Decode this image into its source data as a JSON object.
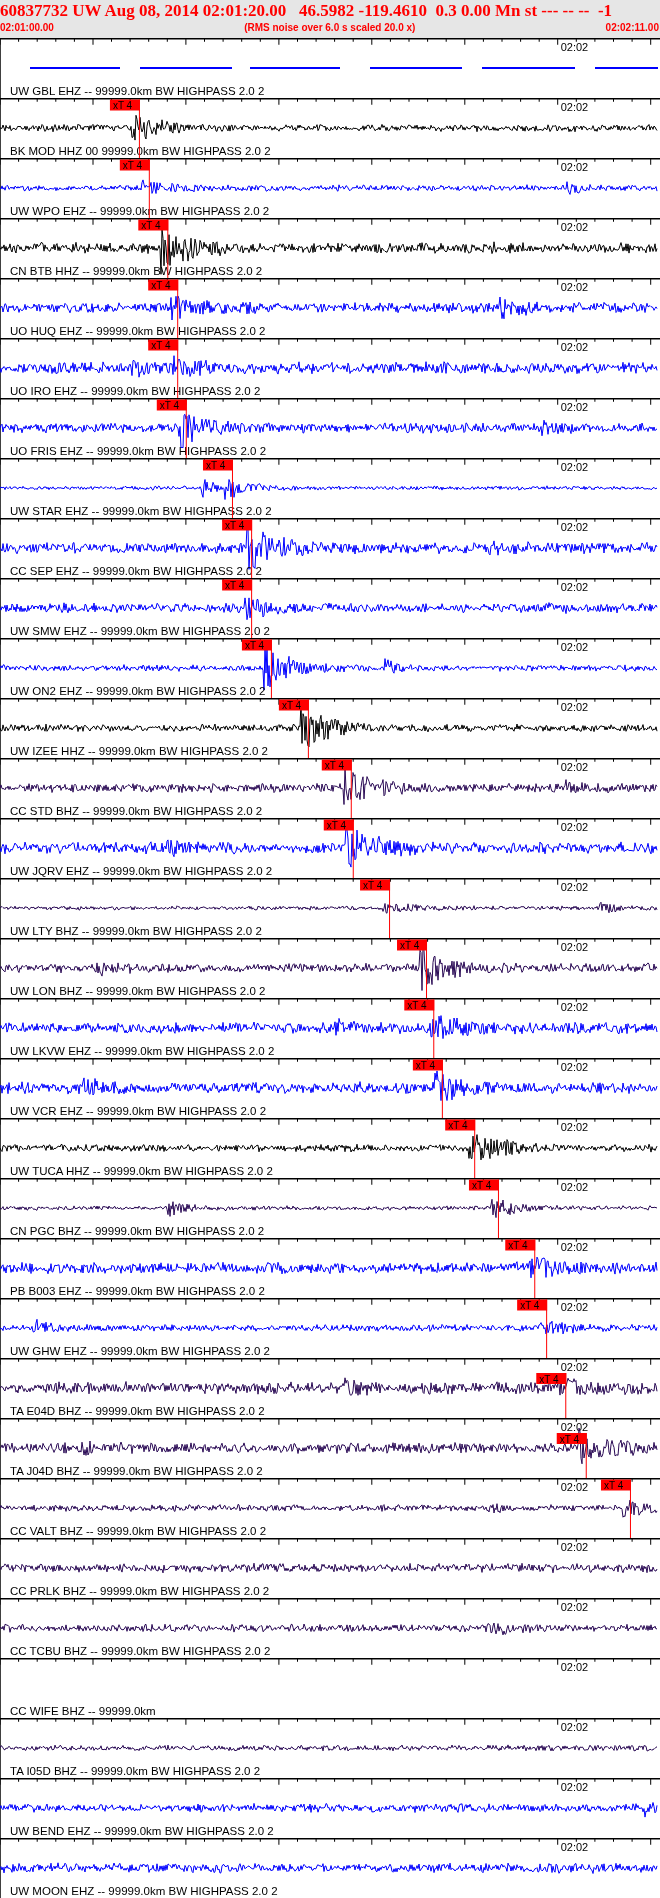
{
  "header": {
    "title": "60837732 UW Aug 08, 2014 02:01:20.00   46.5982 -119.4610  0.3 0.00 Mn st --- -- --  -1",
    "start_time": "02:01:00.00",
    "note": "(RMS noise over 6.0 s scaled 20.0 x)",
    "end_time": "02:02:11.00"
  },
  "traces": [
    {
      "kind": "gapped",
      "color": "#0000ff",
      "tick_label": "02:02",
      "label": "UW GBL EHZ -- 99999.0km BW HIGHPASS 2.0 2"
    },
    {
      "kind": "waveform",
      "color": "#000000",
      "tick_label": "02:02",
      "label": "BK MOD HHZ 00 99999.0km BW HIGHPASS 2.0 2",
      "pick": {
        "label": "xT 4",
        "level": 0.212
      }
    },
    {
      "kind": "waveform",
      "color": "#0000ff",
      "tick_label": "02:02",
      "label": "UW WPO EHZ -- 99999.0km BW HIGHPASS 2.0 2",
      "pick": {
        "label": "xT 4",
        "level": 0.227
      }
    },
    {
      "kind": "waveform",
      "color": "#000000",
      "tick_label": "02:02",
      "label": "CN BTB HHZ -- 99999.0km BW HIGHPASS 2.0 2",
      "pick": {
        "label": "xT 4",
        "level": 0.255
      }
    },
    {
      "kind": "waveform",
      "color": "#0000ff",
      "tick_label": "02:02",
      "label": "UO HUQ EHZ -- 99999.0km BW HIGHPASS 2.0 2",
      "pick": {
        "label": "xT 4",
        "level": 0.27
      }
    },
    {
      "kind": "waveform",
      "color": "#0000ff",
      "tick_label": "02:02",
      "label": "UO IRO EHZ -- 99999.0km BW HIGHPASS 2.0 2",
      "pick": {
        "label": "xT 4",
        "level": 0.27
      }
    },
    {
      "kind": "waveform",
      "color": "#0000ff",
      "tick_label": "02:02",
      "label": "UO FRIS EHZ -- 99999.0km BW HIGHPASS 2.0 2",
      "pick": {
        "label": "xT 4",
        "level": 0.283
      }
    },
    {
      "kind": "waveform",
      "color": "#0000ff",
      "tick_label": "02:02",
      "label": "UW STAR EHZ -- 99999.0km BW HIGHPASS 2.0 2",
      "pick": {
        "label": "xT 4",
        "level": 0.353
      }
    },
    {
      "kind": "waveform",
      "color": "#0000ff",
      "tick_label": "02:02",
      "label": "CC SEP EHZ -- 99999.0km BW HIGHPASS 2.0 2",
      "pick": {
        "label": "xT 4",
        "level": 0.382
      }
    },
    {
      "kind": "waveform",
      "color": "#0000ff",
      "tick_label": "02:02",
      "label": "UW SMW EHZ -- 99999.0km BW HIGHPASS 2.0 2",
      "pick": {
        "label": "xT 4",
        "level": 0.382
      }
    },
    {
      "kind": "waveform",
      "color": "#0000ff",
      "tick_label": "02:02",
      "label": "UW ON2 EHZ -- 99999.0km BW HIGHPASS 2.0 2",
      "pick": {
        "label": "xT 4",
        "level": 0.412
      }
    },
    {
      "kind": "waveform",
      "color": "#000000",
      "tick_label": "02:02",
      "label": "UW IZEE HHZ -- 99999.0km BW HIGHPASS 2.0 2",
      "pick": {
        "label": "xT 4",
        "level": 0.468
      }
    },
    {
      "kind": "waveform",
      "color": "#2a0a55",
      "tick_label": "02:02",
      "label": "CC STD BHZ -- 99999.0km BW HIGHPASS 2.0 2",
      "pick": {
        "label": "xT 4",
        "level": 0.533
      }
    },
    {
      "kind": "waveform",
      "color": "#0000ff",
      "tick_label": "02:02",
      "label": "UW JQRV EHZ -- 99999.0km BW HIGHPASS 2.0 2",
      "pick": {
        "label": "xT 4",
        "level": 0.536
      }
    },
    {
      "kind": "waveform",
      "color": "#2a0a55",
      "tick_label": "02:02",
      "label": "UW LTY BHZ -- 99999.0km BW HIGHPASS 2.0 2",
      "pick": {
        "label": "xT 4",
        "level": 0.591
      }
    },
    {
      "kind": "waveform",
      "color": "#2a0a55",
      "tick_label": "02:02",
      "label": "UW LON BHZ -- 99999.0km BW HIGHPASS 2.0 2",
      "pick": {
        "label": "xT 4",
        "level": 0.647
      }
    },
    {
      "kind": "waveform",
      "color": "#0000ff",
      "tick_label": "02:02",
      "label": "UW LKVW EHZ -- 99999.0km BW HIGHPASS 2.0 2",
      "pick": {
        "label": "xT 4",
        "level": 0.658
      }
    },
    {
      "kind": "waveform",
      "color": "#0000ff",
      "tick_label": "02:02",
      "label": "UW VCR EHZ -- 99999.0km BW HIGHPASS 2.0 2",
      "pick": {
        "label": "xT 4",
        "level": 0.671
      }
    },
    {
      "kind": "waveform",
      "color": "#000000",
      "tick_label": "02:02",
      "label": "UW TUCA HHZ -- 99999.0km BW HIGHPASS 2.0 2",
      "pick": {
        "label": "xT 4",
        "level": 0.72
      }
    },
    {
      "kind": "waveform",
      "color": "#2a0a55",
      "tick_label": "02:02",
      "label": "CN PGC BHZ -- 99999.0km BW HIGHPASS 2.0 2",
      "pick": {
        "label": "xT 4",
        "level": 0.756
      }
    },
    {
      "kind": "waveform",
      "color": "#0000ff",
      "tick_label": "02:02",
      "label": "PB B003 EHZ -- 99999.0km BW HIGHPASS 2.0 2",
      "pick": {
        "label": "xT 4",
        "level": 0.811
      }
    },
    {
      "kind": "waveform",
      "color": "#0000ff",
      "tick_label": "02:02",
      "label": "UW GHW EHZ -- 99999.0km BW HIGHPASS 2.0 2",
      "pick": {
        "label": "xT 4",
        "level": 0.829
      }
    },
    {
      "kind": "waveform",
      "color": "#2a0a55",
      "tick_label": "02:02",
      "label": "TA E04D BHZ -- 99999.0km BW HIGHPASS 2.0 2",
      "pick": {
        "label": "xT 4",
        "level": 0.858
      }
    },
    {
      "kind": "waveform",
      "color": "#2a0a55",
      "tick_label": "02:02",
      "label": "TA J04D BHZ -- 99999.0km BW HIGHPASS 2.0 2",
      "pick": {
        "label": "xT 4",
        "level": 0.889
      }
    },
    {
      "kind": "waveform",
      "color": "#2a0a55",
      "tick_label": "02:02",
      "label": "CC VALT BHZ -- 99999.0km BW HIGHPASS 2.0 2",
      "pick": {
        "label": "xT 4",
        "level": 0.956
      }
    },
    {
      "kind": "waveform",
      "color": "#2a0a55",
      "tick_label": "02:02",
      "label": "CC PRLK BHZ -- 99999.0km BW HIGHPASS 2.0 2"
    },
    {
      "kind": "waveform",
      "color": "#2a0a55",
      "tick_label": "02:02",
      "label": "CC TCBU BHZ -- 99999.0km BW HIGHPASS 2.0 2"
    },
    {
      "kind": "blank",
      "tick_label": "02:02",
      "label": "CC WIFE BHZ -- 99999.0km"
    },
    {
      "kind": "waveform",
      "color": "#2a0a55",
      "tick_label": "02:02",
      "label": "TA I05D BHZ -- 99999.0km BW HIGHPASS 2.0 2"
    },
    {
      "kind": "waveform",
      "color": "#0000ff",
      "tick_label": "02:02",
      "label": "UW BEND EHZ -- 99999.0km BW HIGHPASS 2.0 2"
    },
    {
      "kind": "waveform",
      "color": "#0000ff",
      "tick_label": "02:02",
      "label": "UW MOON EHZ -- 99999.0km BW HIGHPASS 2.0 2"
    }
  ]
}
